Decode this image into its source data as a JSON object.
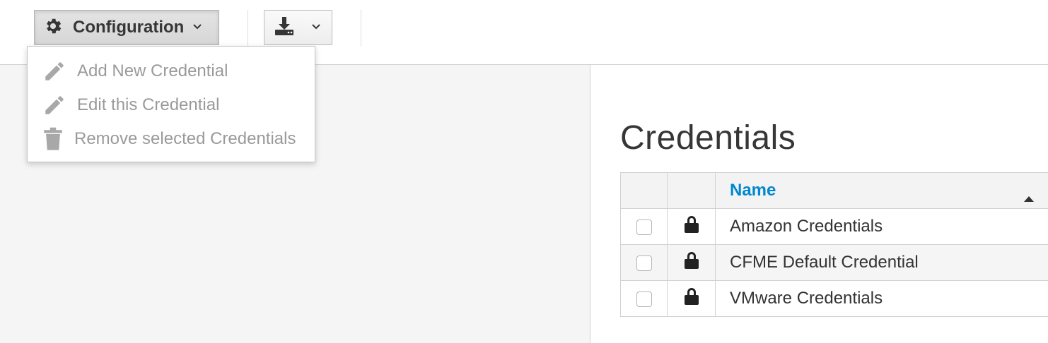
{
  "toolbar": {
    "configuration_label": "Configuration",
    "configuration_icon": "gear-icon",
    "download_icon": "download-icon"
  },
  "config_menu": {
    "items": [
      {
        "label": "Add New Credential",
        "icon": "pencil-icon",
        "enabled": false
      },
      {
        "label": "Edit this Credential",
        "icon": "pencil-icon",
        "enabled": false
      },
      {
        "label": "Remove selected Credentials",
        "icon": "trash-icon",
        "enabled": false
      }
    ]
  },
  "main": {
    "title": "Credentials",
    "table": {
      "columns": [
        "",
        "",
        "Name"
      ],
      "sort": {
        "column": "Name",
        "direction": "ascending"
      },
      "rows": [
        {
          "name": "Amazon Credentials",
          "icon": "lock-icon",
          "checked": false
        },
        {
          "name": "CFME Default Credential",
          "icon": "lock-icon",
          "checked": false
        },
        {
          "name": "VMware Credentials",
          "icon": "lock-icon",
          "checked": false
        }
      ]
    }
  },
  "colors": {
    "accent_link": "#0088ce",
    "disabled_text": "#9a9a9a",
    "pane_background": "#f5f5f5"
  }
}
